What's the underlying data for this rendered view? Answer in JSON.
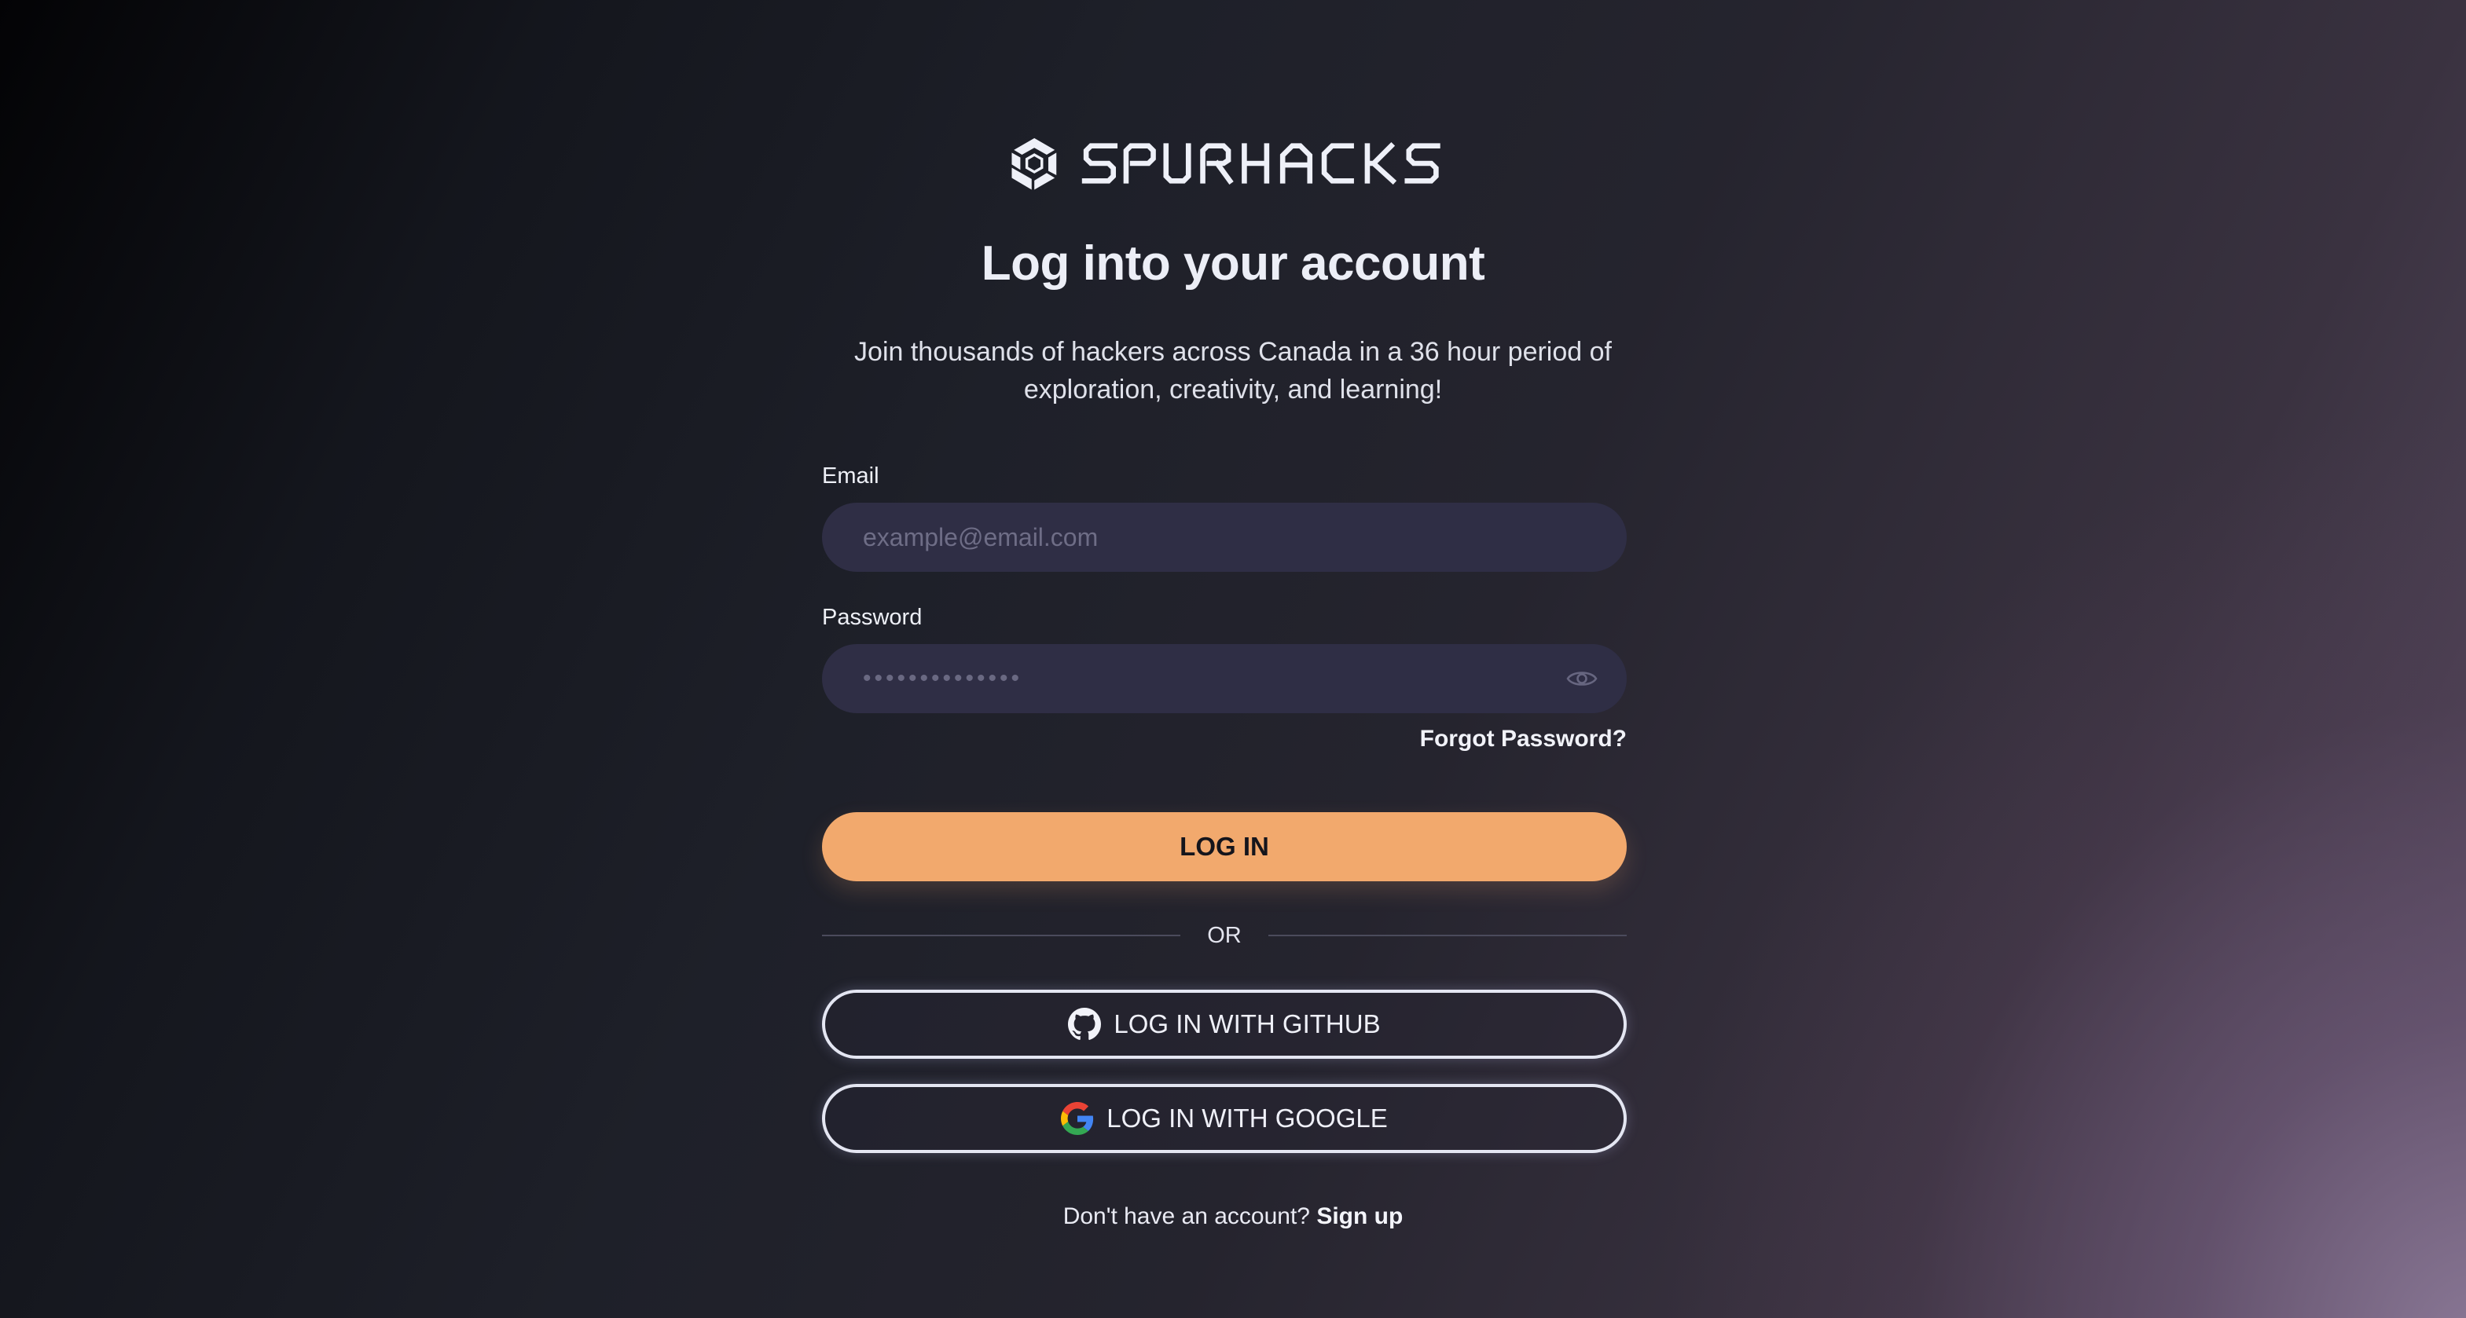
{
  "brand": {
    "name": "SPURHACKS",
    "logo_icon": "spurhacks-logo-icon"
  },
  "login": {
    "title": "Log into your account",
    "subtitle": "Join thousands of hackers across Canada in a 36 hour period of exploration, creativity, and learning!",
    "email": {
      "label": "Email",
      "placeholder": "example@email.com",
      "value": ""
    },
    "password": {
      "label": "Password",
      "masked_value": "••••••••••••••",
      "toggle_icon": "eye-icon"
    },
    "forgot_password": "Forgot Password?",
    "submit_label": "LOG IN",
    "divider_text": "OR",
    "github_label": "LOG IN WITH GITHUB",
    "google_label": "LOG IN WITH GOOGLE",
    "signup_prompt": "Don't have an account?",
    "signup_link": "Sign up"
  },
  "colors": {
    "primary_button": "#f2a96d",
    "input_background": "#2f2e45",
    "text": "#e8e9f2"
  }
}
